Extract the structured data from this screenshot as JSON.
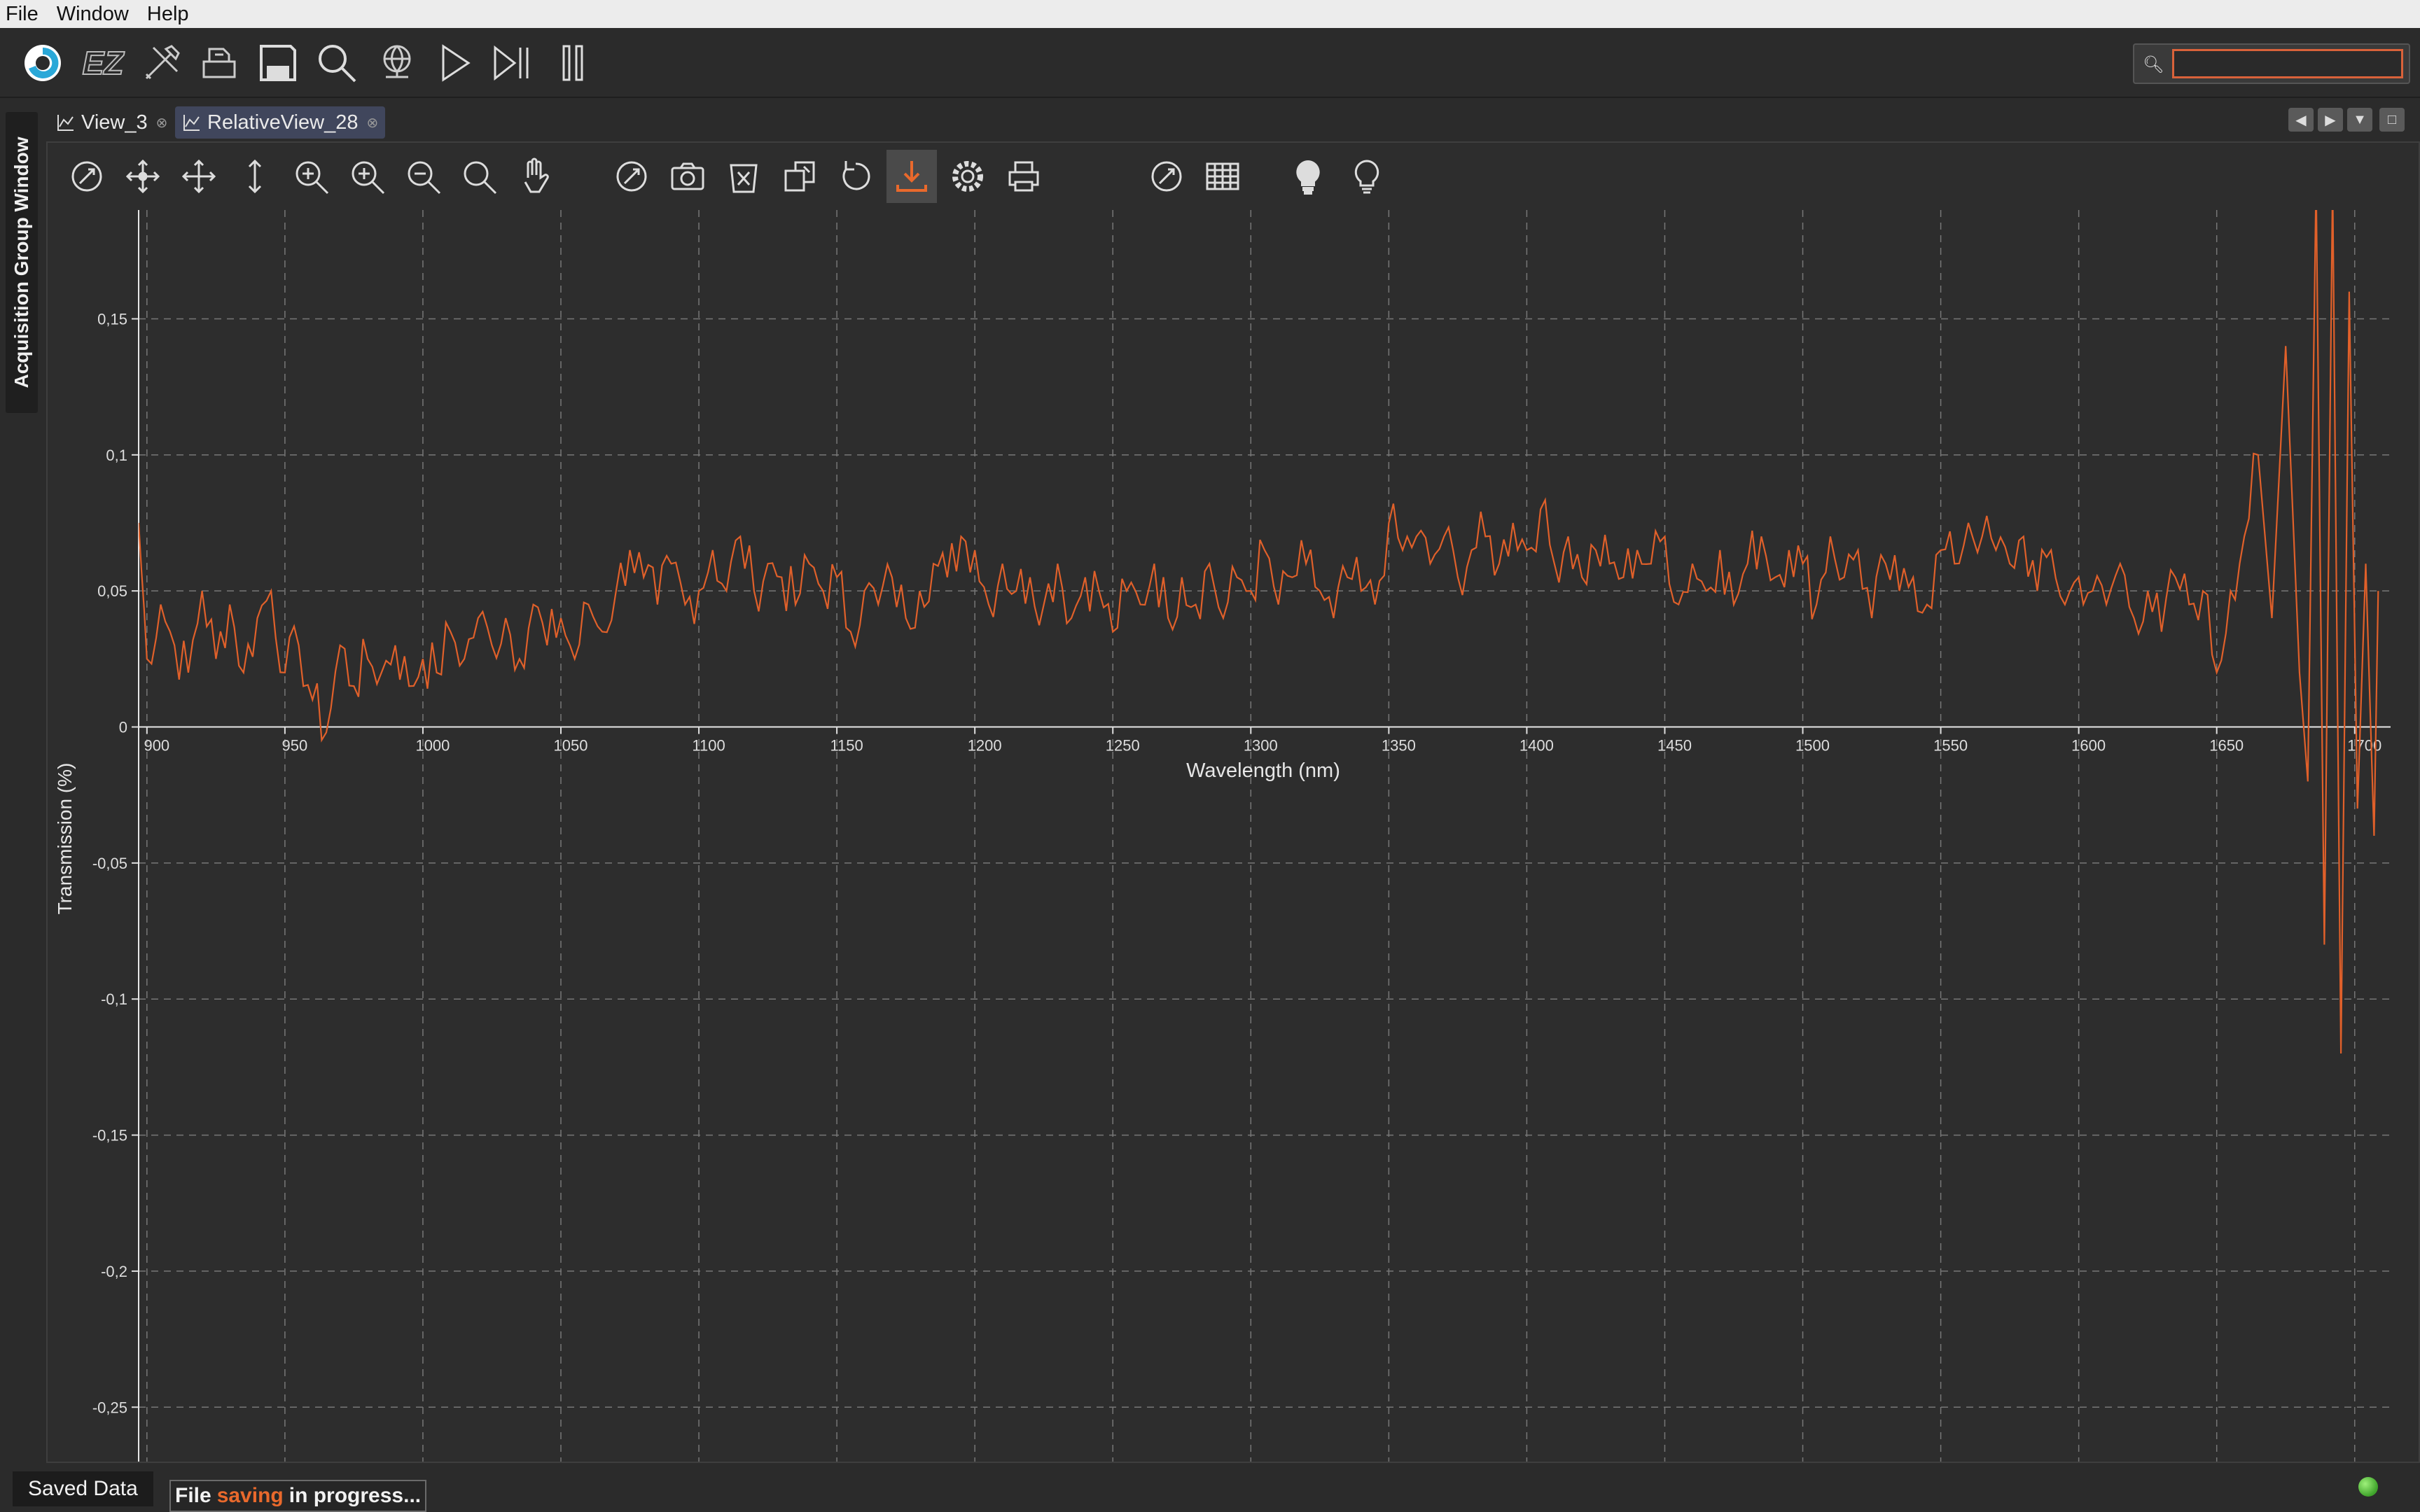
{
  "menu": {
    "items": [
      "File",
      "Window",
      "Help"
    ]
  },
  "toolbar": {
    "icons": [
      "app-logo-icon",
      "ez-icon",
      "tools-icon",
      "print-setup-icon",
      "save-icon",
      "search-icon",
      "globe-icon",
      "play-icon",
      "step-icon",
      "pause-icon"
    ],
    "ez_label": "EZ"
  },
  "search": {
    "placeholder": "",
    "value": ""
  },
  "side_panel": {
    "title": "Acquisition Group Window"
  },
  "tabs": [
    {
      "label": "View_3",
      "active": false
    },
    {
      "label": "RelativeView_28",
      "active": true
    }
  ],
  "plot_toolbar": {
    "icons": [
      "reset-view-icon",
      "pan-icon",
      "move-icon",
      "vertical-pan-icon",
      "zoom-fit-icon",
      "zoom-in-icon",
      "zoom-out-icon",
      "zoom-icon",
      "hand-icon",
      "refresh-icon",
      "camera-icon",
      "clear-icon",
      "export-icon",
      "undo-icon",
      "download-icon",
      "settings-icon",
      "print-icon",
      "reset-icon",
      "table-icon",
      "bulb-on-icon",
      "bulb-off-icon"
    ],
    "active": "download-icon"
  },
  "chart_data": {
    "type": "line",
    "xlabel": "Wavelength (nm)",
    "ylabel": "Transmission (%)",
    "xlim": [
      897,
      1713
    ],
    "ylim": [
      -0.27,
      0.19
    ],
    "x_ticks": [
      {
        "v": 900,
        "label": "900"
      },
      {
        "v": 950,
        "label": "950"
      },
      {
        "v": 1000,
        "label": "1000"
      },
      {
        "v": 1050,
        "label": "1050"
      },
      {
        "v": 1100,
        "label": "1100"
      },
      {
        "v": 1150,
        "label": "1150"
      },
      {
        "v": 1200,
        "label": "1200"
      },
      {
        "v": 1250,
        "label": "1250"
      },
      {
        "v": 1300,
        "label": "1300"
      },
      {
        "v": 1350,
        "label": "1350"
      },
      {
        "v": 1400,
        "label": "1400"
      },
      {
        "v": 1450,
        "label": "1450"
      },
      {
        "v": 1500,
        "label": "1500"
      },
      {
        "v": 1550,
        "label": "1550"
      },
      {
        "v": 1600,
        "label": "1600"
      },
      {
        "v": 1650,
        "label": "1650"
      },
      {
        "v": 1700,
        "label": "1700"
      }
    ],
    "y_ticks": [
      {
        "v": 0.15,
        "label": "0,15"
      },
      {
        "v": 0.1,
        "label": "0,1"
      },
      {
        "v": 0.05,
        "label": "0,05"
      },
      {
        "v": 0,
        "label": "0"
      },
      {
        "v": -0.05,
        "label": "-0,05"
      },
      {
        "v": -0.1,
        "label": "-0,1"
      },
      {
        "v": -0.15,
        "label": "-0,15"
      },
      {
        "v": -0.2,
        "label": "-0,2"
      },
      {
        "v": -0.25,
        "label": "-0,25"
      }
    ],
    "grid": true,
    "series_color": "#e0602a",
    "x": [
      897,
      900,
      905,
      910,
      915,
      920,
      925,
      930,
      935,
      940,
      945,
      950,
      955,
      960,
      965,
      970,
      975,
      980,
      985,
      990,
      995,
      1000,
      1005,
      1010,
      1015,
      1020,
      1025,
      1030,
      1035,
      1040,
      1045,
      1050,
      1055,
      1060,
      1065,
      1070,
      1075,
      1080,
      1085,
      1090,
      1095,
      1100,
      1105,
      1110,
      1115,
      1120,
      1125,
      1130,
      1135,
      1140,
      1145,
      1150,
      1155,
      1160,
      1165,
      1170,
      1175,
      1180,
      1185,
      1190,
      1195,
      1200,
      1205,
      1210,
      1215,
      1220,
      1225,
      1230,
      1235,
      1240,
      1245,
      1250,
      1255,
      1260,
      1265,
      1270,
      1275,
      1280,
      1285,
      1290,
      1295,
      1300,
      1305,
      1310,
      1315,
      1320,
      1325,
      1330,
      1335,
      1340,
      1345,
      1350,
      1355,
      1360,
      1365,
      1370,
      1375,
      1380,
      1385,
      1390,
      1395,
      1400,
      1405,
      1410,
      1415,
      1420,
      1425,
      1430,
      1435,
      1440,
      1445,
      1450,
      1455,
      1460,
      1465,
      1470,
      1475,
      1480,
      1485,
      1490,
      1495,
      1500,
      1505,
      1510,
      1515,
      1520,
      1525,
      1530,
      1535,
      1540,
      1545,
      1550,
      1555,
      1560,
      1565,
      1570,
      1575,
      1580,
      1585,
      1590,
      1595,
      1600,
      1605,
      1610,
      1615,
      1620,
      1625,
      1630,
      1635,
      1640,
      1645,
      1650,
      1655,
      1660,
      1665,
      1670,
      1675,
      1680,
      1683,
      1686,
      1689,
      1692,
      1695,
      1698,
      1701,
      1704,
      1707,
      1710,
      1713
    ],
    "y": [
      0.075,
      0.025,
      0.045,
      0.03,
      0.02,
      0.05,
      0.025,
      0.045,
      0.02,
      0.04,
      0.05,
      0.02,
      0.03,
      0.01,
      -0.002,
      0.03,
      0.015,
      0.025,
      0.02,
      0.03,
      0.015,
      0.025,
      0.02,
      0.035,
      0.025,
      0.04,
      0.03,
      0.04,
      0.025,
      0.045,
      0.03,
      0.04,
      0.025,
      0.045,
      0.035,
      0.05,
      0.065,
      0.055,
      0.045,
      0.06,
      0.045,
      0.05,
      0.065,
      0.05,
      0.07,
      0.05,
      0.06,
      0.055,
      0.045,
      0.06,
      0.05,
      0.055,
      0.035,
      0.05,
      0.045,
      0.055,
      0.04,
      0.05,
      0.06,
      0.055,
      0.07,
      0.065,
      0.045,
      0.06,
      0.05,
      0.055,
      0.045,
      0.06,
      0.04,
      0.055,
      0.05,
      0.035,
      0.05,
      0.045,
      0.06,
      0.04,
      0.055,
      0.045,
      0.06,
      0.04,
      0.055,
      0.05,
      0.065,
      0.045,
      0.055,
      0.06,
      0.05,
      0.04,
      0.055,
      0.05,
      0.045,
      0.075,
      0.065,
      0.07,
      0.06,
      0.07,
      0.055,
      0.065,
      0.07,
      0.06,
      0.075,
      0.065,
      0.08,
      0.06,
      0.07,
      0.055,
      0.065,
      0.06,
      0.055,
      0.065,
      0.06,
      0.07,
      0.045,
      0.06,
      0.05,
      0.065,
      0.045,
      0.06,
      0.07,
      0.055,
      0.065,
      0.06,
      0.045,
      0.07,
      0.055,
      0.065,
      0.04,
      0.06,
      0.05,
      0.055,
      0.045,
      0.065,
      0.06,
      0.075,
      0.07,
      0.065,
      0.06,
      0.07,
      0.05,
      0.065,
      0.045,
      0.055,
      0.05,
      0.045,
      0.06,
      0.04,
      0.05,
      0.035,
      0.055,
      0.045,
      0.05,
      0.02,
      0.05,
      0.07,
      0.1,
      0.04,
      0.14,
      0.02,
      -0.02,
      0.2,
      -0.08,
      0.2,
      -0.12,
      0.16,
      -0.03,
      0.06,
      -0.04,
      0.14
    ]
  },
  "status": {
    "saved_data_label": "Saved Data",
    "msg_prefix": "File",
    "msg_highlight": "saving",
    "msg_suffix": "in progress..."
  }
}
